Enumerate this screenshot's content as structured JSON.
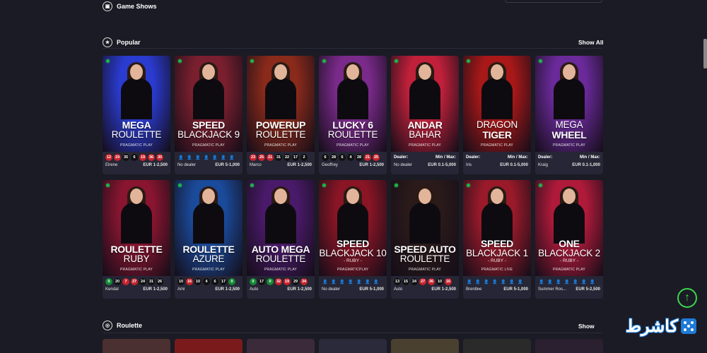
{
  "sections": {
    "game_shows": {
      "title": "Game Shows"
    },
    "popular": {
      "title": "Popular",
      "show_all": "Show All"
    },
    "roulette": {
      "title": "Roulette",
      "show_all": "Show"
    }
  },
  "games_row1": [
    {
      "t1": "MEGA",
      "t2": "ROULETTE",
      "t3": "",
      "provider": "PRAGMATIC PLAY",
      "dealer": "Elrene",
      "limit": "EUR 1-2,500",
      "kind": "numbers",
      "numbers": [
        {
          "n": "12",
          "c": "red"
        },
        {
          "n": "19",
          "c": "red"
        },
        {
          "n": "35",
          "c": "black"
        },
        {
          "n": "6",
          "c": "black"
        },
        {
          "n": "19",
          "c": "red"
        },
        {
          "n": "36",
          "c": "red"
        },
        {
          "n": "30",
          "c": "red"
        }
      ]
    },
    {
      "t1": "SPEED",
      "t2": "BLACKJACK 9",
      "t3": "",
      "provider": "PRAGMATIC PLAY",
      "dealer": "No dealer",
      "limit": "EUR 5-1,000",
      "kind": "seats"
    },
    {
      "t1": "POWERUP",
      "t2": "ROULETTE",
      "t3": "",
      "provider": "PRAGMATIC PLAY",
      "dealer": "Marco",
      "limit": "EUR 1-2,500",
      "kind": "numbers",
      "numbers": [
        {
          "n": "23",
          "c": "red"
        },
        {
          "n": "25",
          "c": "red"
        },
        {
          "n": "21",
          "c": "red"
        },
        {
          "n": "31",
          "c": "black"
        },
        {
          "n": "22",
          "c": "black"
        },
        {
          "n": "17",
          "c": "black"
        },
        {
          "n": "2",
          "c": "black"
        }
      ]
    },
    {
      "t1": "LUCKY 6",
      "t2": "ROULETTE",
      "t3": "",
      "provider": "PRAGMATIC PLAY",
      "dealer": "Geoffrey",
      "limit": "EUR 1-2,500",
      "kind": "numbers",
      "numbers": [
        {
          "n": "6",
          "c": "black"
        },
        {
          "n": "28",
          "c": "black"
        },
        {
          "n": "6",
          "c": "black"
        },
        {
          "n": "4",
          "c": "black"
        },
        {
          "n": "28",
          "c": "black"
        },
        {
          "n": "21",
          "c": "red"
        },
        {
          "n": "25",
          "c": "red"
        }
      ]
    },
    {
      "t1": "ANDAR",
      "t2": "BAHAR",
      "t3": "",
      "provider": "PRAGMATIC PLAY",
      "dealer_label": "Dealer:",
      "minmax_label": "Min / Max:",
      "dealer": "No dealer",
      "limit": "EUR 0.1-5,000",
      "kind": "dealer"
    },
    {
      "t1": "",
      "t2": "DRAGON",
      "t1b": "TIGER",
      "t3": "",
      "provider": "PRAGMATIC PLAY",
      "dealer_label": "Dealer:",
      "minmax_label": "Min / Max:",
      "dealer": "Iris",
      "limit": "EUR 0.1-5,000",
      "kind": "dealer"
    },
    {
      "t1": "",
      "t2": "MEGA",
      "t1b": "WHEEL",
      "t3": "",
      "provider": "PRAGMATIC PLAY",
      "dealer_label": "Dealer:",
      "minmax_label": "Min / Max:",
      "dealer": "Kraig",
      "limit": "EUR 0.1-1,000",
      "kind": "dealer"
    }
  ],
  "games_row2": [
    {
      "t1": "ROULETTE",
      "t2": "RUBY",
      "t3": "",
      "provider": "PRAGMATIC PLAY",
      "dealer": "Kendal",
      "limit": "EUR 1-2,500",
      "kind": "numbers",
      "numbers": [
        {
          "n": "0",
          "c": "green"
        },
        {
          "n": "20",
          "c": "black"
        },
        {
          "n": "7",
          "c": "red"
        },
        {
          "n": "27",
          "c": "red"
        },
        {
          "n": "24",
          "c": "black"
        },
        {
          "n": "31",
          "c": "black"
        },
        {
          "n": "26",
          "c": "black"
        }
      ]
    },
    {
      "t1": "ROULETTE",
      "t2": "AZURE",
      "t3": "",
      "provider": "PRAGMATIC PLAY",
      "dealer": "Ami",
      "limit": "EUR 1-2,500",
      "kind": "numbers",
      "numbers": [
        {
          "n": "10",
          "c": "black"
        },
        {
          "n": "16",
          "c": "red"
        },
        {
          "n": "10",
          "c": "black"
        },
        {
          "n": "4",
          "c": "black"
        },
        {
          "n": "6",
          "c": "black"
        },
        {
          "n": "17",
          "c": "black"
        },
        {
          "n": "0",
          "c": "green"
        }
      ]
    },
    {
      "t1": "AUTO MEGA",
      "t2": "ROULETTE",
      "t3": "",
      "provider": "PRAGMATIC PLAY",
      "dealer": "Auto",
      "limit": "EUR 1-2,500",
      "kind": "numbers",
      "numbers": [
        {
          "n": "0",
          "c": "green"
        },
        {
          "n": "17",
          "c": "black"
        },
        {
          "n": "0",
          "c": "green"
        },
        {
          "n": "32",
          "c": "red"
        },
        {
          "n": "19",
          "c": "red"
        },
        {
          "n": "29",
          "c": "black"
        },
        {
          "n": "34",
          "c": "red"
        }
      ]
    },
    {
      "t1": "SPEED",
      "t2": "BLACKJACK 10",
      "t3": "- RUBY -",
      "provider": "PRAGMATICPLAY",
      "dealer": "No dealer",
      "limit": "EUR 5-1,000",
      "kind": "seats"
    },
    {
      "t1": "SPEED AUTO",
      "t2": "ROULETTE",
      "t3": "",
      "provider": "PRAGMATIC PLAY",
      "dealer": "Auto",
      "limit": "EUR 1-2,500",
      "kind": "numbers",
      "numbers": [
        {
          "n": "13",
          "c": "black"
        },
        {
          "n": "15",
          "c": "black"
        },
        {
          "n": "24",
          "c": "black"
        },
        {
          "n": "27",
          "c": "red"
        },
        {
          "n": "36",
          "c": "red"
        },
        {
          "n": "10",
          "c": "black"
        },
        {
          "n": "16",
          "c": "red"
        }
      ]
    },
    {
      "t1": "SPEED",
      "t2": "BLACKJACK 1",
      "t3": "- RUBY -",
      "provider": "PRAGMATIC LIVE",
      "dealer": "Brentlee",
      "limit": "EUR 5-1,000",
      "kind": "seats"
    },
    {
      "t1": "ONE",
      "t2": "BLACKJACK 2",
      "t3": "- RUBY -",
      "provider": "PRAGMATIC PLAY",
      "dealer": "Summer Ros...",
      "limit": "EUR 5-2,500",
      "kind": "seats"
    }
  ],
  "theme": {
    "row1": [
      "#2a3bd0",
      "#7a1f2e",
      "#8a2a1a",
      "#7a2a8a",
      "#c0203a",
      "#a81818",
      "#6a2a9a"
    ],
    "row2": [
      "#8a1530",
      "#1a4a9a",
      "#4a1a6a",
      "#8a1525",
      "#2a1a1a",
      "#9a1a2a",
      "#b01a3a"
    ]
  },
  "logo": {
    "text": "کاشرط"
  }
}
